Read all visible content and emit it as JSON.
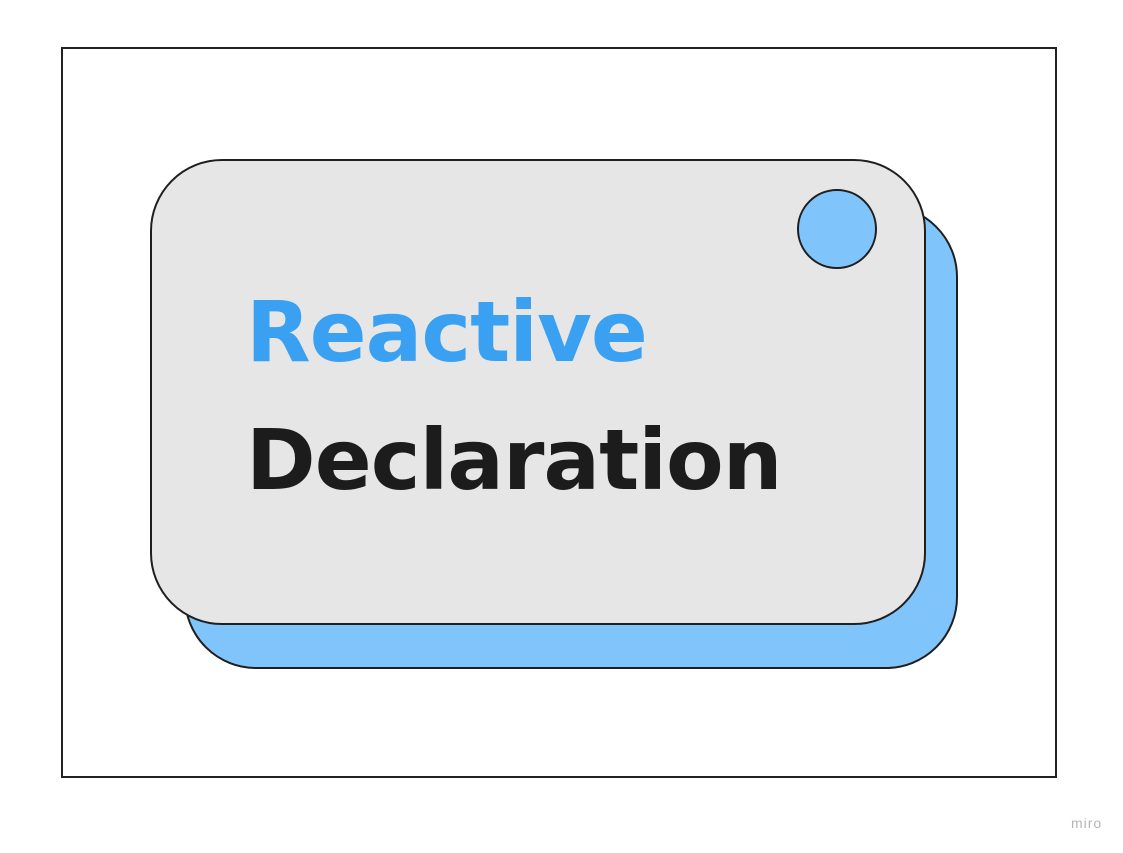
{
  "card": {
    "line_1": "Reactive",
    "line_2": "Declaration"
  },
  "watermark": "miro",
  "colors": {
    "accent_text": "#3aa0f2",
    "main_text": "#1c1c1c",
    "card_fill": "#e6e6e6",
    "accent_fill": "#80c4fc",
    "outline": "#1f1f1f"
  }
}
